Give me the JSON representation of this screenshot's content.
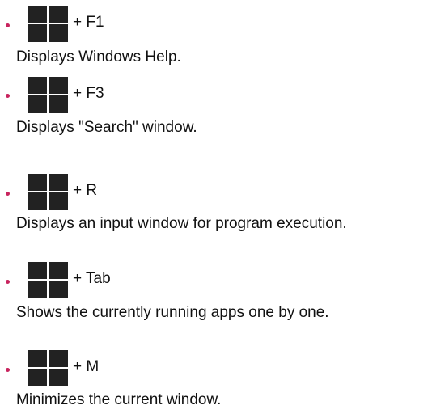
{
  "shortcuts": [
    {
      "key": "+ F1",
      "description": "Displays Windows Help.",
      "icon": "windows-logo-icon"
    },
    {
      "key": "+ F3",
      "description": "Displays \"Search\" window.",
      "icon": "windows-logo-icon"
    },
    {
      "key": "+ R",
      "description": "Displays an input window for program execution.",
      "icon": "windows-logo-icon"
    },
    {
      "key": "+ Tab",
      "description": "Shows the currently running apps one by one.",
      "icon": "windows-logo-icon"
    },
    {
      "key": "+ M",
      "description": "Minimizes the current window.",
      "icon": "windows-logo-icon"
    }
  ],
  "colors": {
    "bullet": "#c8245e",
    "logo": "#222222",
    "text": "#111111"
  }
}
